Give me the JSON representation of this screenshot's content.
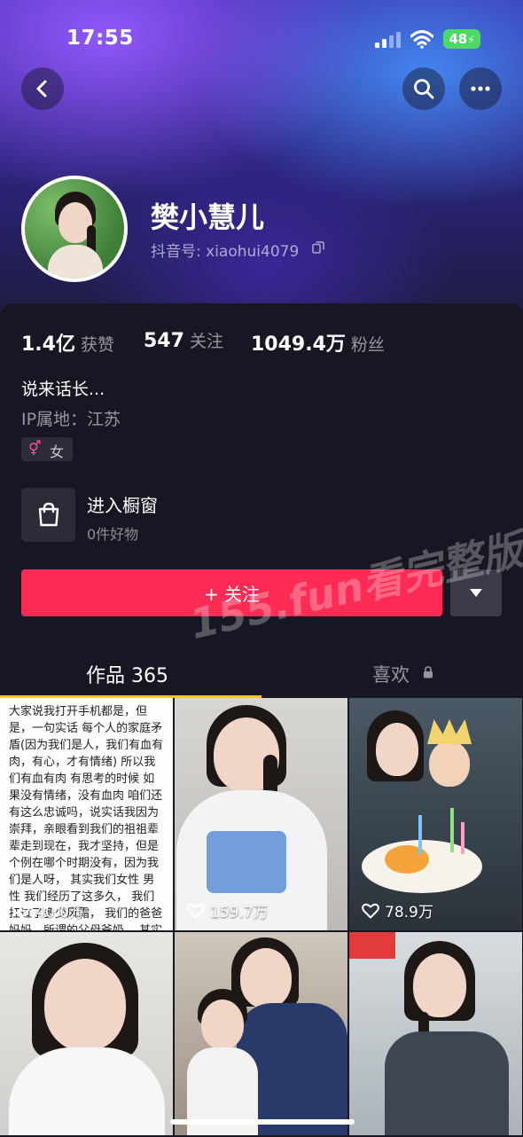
{
  "status_bar": {
    "time": "17:55",
    "battery": "48"
  },
  "profile": {
    "name": "樊小慧儿",
    "douyin_id": "抖音号: xiaohui4079",
    "likes_num": "1.4亿",
    "likes_label": "获赞",
    "following_num": "547",
    "following_label": "关注",
    "followers_num": "1049.4万",
    "followers_label": "粉丝",
    "bio": "说来话长...",
    "ip": "IP属地：江苏",
    "gender_symbol": "⚥",
    "gender": "女"
  },
  "shop": {
    "title": "进入橱窗",
    "subtitle": "0件好物"
  },
  "actions": {
    "follow_label": "+ 关注"
  },
  "tabs": {
    "works": "作品 365",
    "liked": "喜欢"
  },
  "watermark": "155.fun看完整版",
  "videos": [
    {
      "likes": "40.0万",
      "text": "大家说我打开手机都是，但是，一句实话 每个人的家庭矛盾(因为我们是人，我们有血有肉，有心，才有情绪) 所以我们有血有肉 有思考的时候 如果没有情绪，没有血肉 咱们还有这么忠诚吗，说实话我因为崇拜，亲眼看到我们的祖祖辈辈走到现在，我才坚持，但是个例在哪个时期没有，因为我们是人呀， 其实我们女性 男性 我们经历了这多久， 我们扛过了多少风霜， 我们的爸爸妈妈，所谓的父母爷奶， 其实是祖辈(他们付出很多很多) 当我 当我们的家园有家之大难题，哪怕为"
    },
    {
      "likes": "159.7万"
    },
    {
      "likes": "78.9万"
    },
    {
      "likes": ""
    },
    {
      "likes": ""
    },
    {
      "likes": ""
    }
  ],
  "colors": {
    "accent": "#fe2c55",
    "tab_indicator": "#f7c52a",
    "background": "#161722"
  }
}
